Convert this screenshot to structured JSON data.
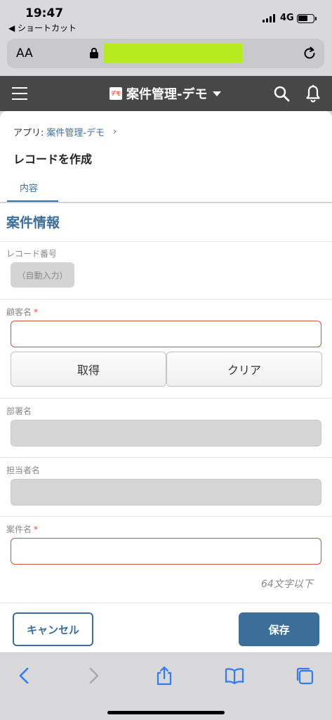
{
  "status_bar": {
    "time": "19:47",
    "back_app": "◀ ショートカット",
    "network": "4G"
  },
  "browser": {
    "text_size_label": "AA"
  },
  "header": {
    "app_logo_text": "デモ",
    "app_title": "案件管理-デモ"
  },
  "breadcrumb": {
    "prefix": "アプリ:",
    "app_link": "案件管理-デモ",
    "chevron": "›"
  },
  "page_title": "レコードを作成",
  "tabs": [
    {
      "label": "内容",
      "active": true
    }
  ],
  "section_title": "案件情報",
  "fields": {
    "record_number": {
      "label": "レコード番号",
      "value": "（自動入力）"
    },
    "customer_name": {
      "label": "顧客名",
      "required_mark": "*",
      "value": ""
    },
    "department": {
      "label": "部署名",
      "value": ""
    },
    "person_in_charge": {
      "label": "担当者名",
      "value": ""
    },
    "project_name": {
      "label": "案件名",
      "required_mark": "*",
      "value": "",
      "hint": "64文字以下"
    }
  },
  "lookup_buttons": {
    "get_label": "取得",
    "clear_label": "クリア"
  },
  "footer": {
    "cancel_label": "キャンセル",
    "save_label": "保存"
  },
  "colors": {
    "accent": "#3b6f9a",
    "header_bg": "#474747",
    "required": "#e74c3c",
    "error_border": "#c9543f",
    "url_highlight": "#b6ec1f"
  },
  "icons": [
    "hamburger-icon",
    "dropdown-caret-icon",
    "search-icon",
    "bell-icon",
    "lock-icon",
    "reload-icon",
    "back-icon",
    "forward-icon",
    "share-icon",
    "bookmarks-icon",
    "tabs-icon"
  ]
}
